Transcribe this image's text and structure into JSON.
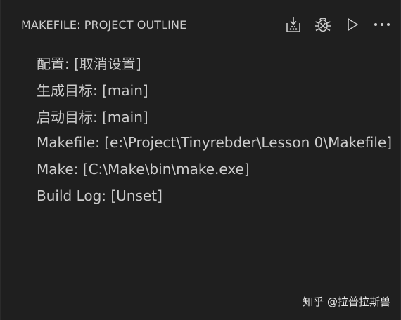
{
  "header": {
    "title": "MAKEFILE: PROJECT OUTLINE",
    "actions": [
      {
        "icon": "install-icon"
      },
      {
        "icon": "debug-icon"
      },
      {
        "icon": "run-icon"
      },
      {
        "icon": "more-icon"
      }
    ]
  },
  "outline": {
    "items": [
      {
        "label": "配置: [取消设置]"
      },
      {
        "label": "生成目标: [main]"
      },
      {
        "label": "启动目标: [main]"
      },
      {
        "label": "Makefile: [e:\\Project\\Tinyrebder\\Lesson 0\\Makefile]"
      },
      {
        "label": "Make: [C:\\Make\\bin\\make.exe]"
      },
      {
        "label": "Build Log: [Unset]"
      }
    ]
  },
  "watermark": {
    "text": "知乎 @拉普拉斯兽"
  },
  "colors": {
    "background": "#1f1f1f",
    "text": "#cccccc"
  }
}
